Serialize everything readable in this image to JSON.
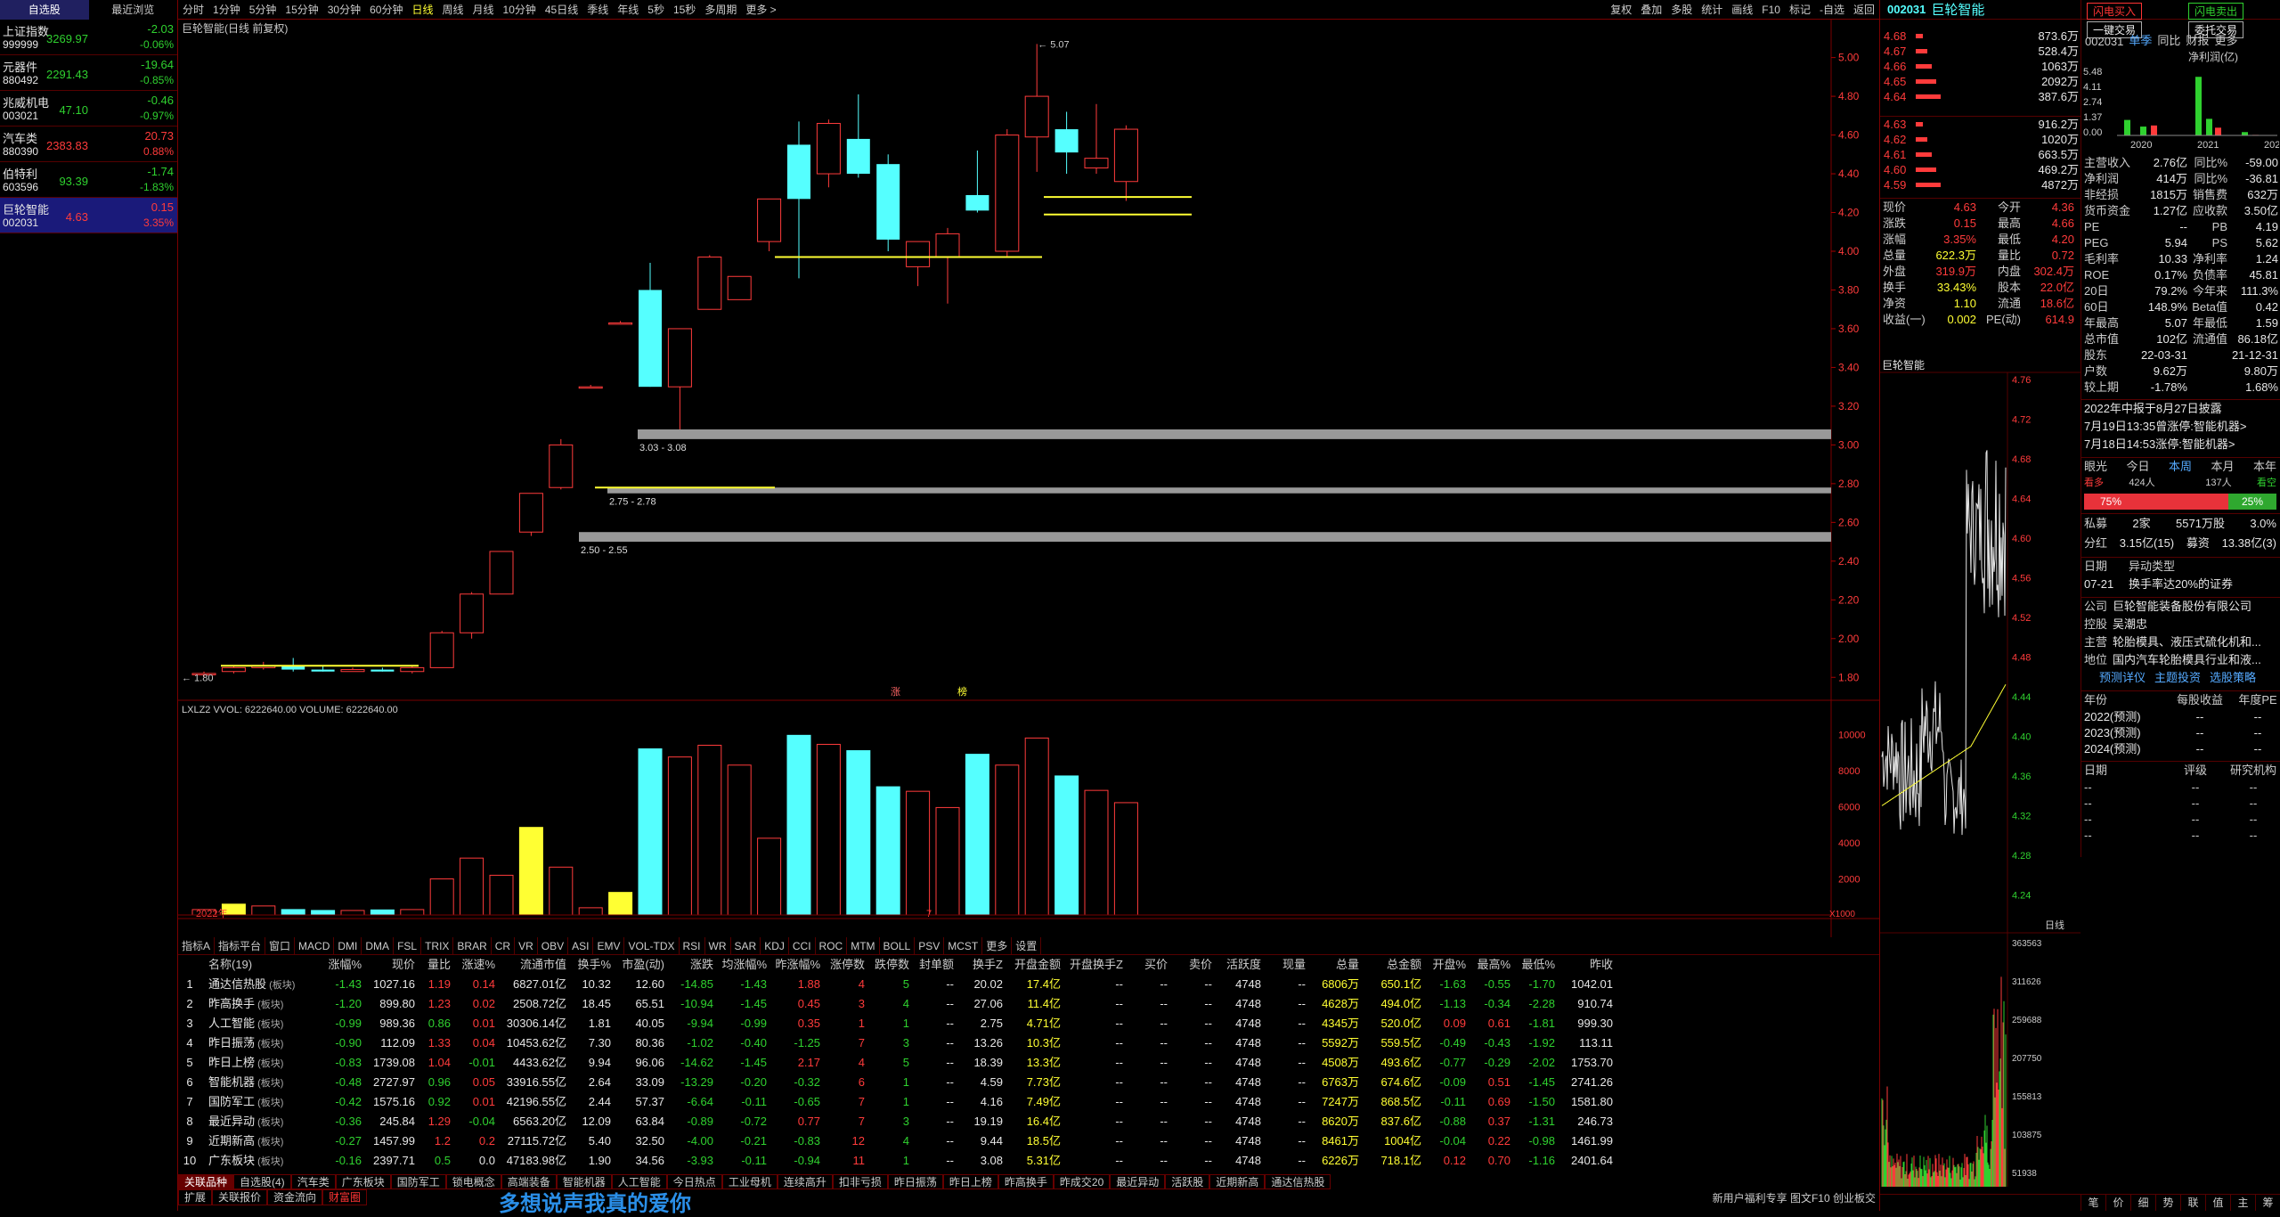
{
  "watchlist": {
    "tabs": [
      "自选股",
      "最近浏览"
    ],
    "items": [
      {
        "name": "上证指数",
        "code": "999999",
        "price": "3269.97",
        "chg": "-2.03",
        "pct": "-0.06%",
        "up": false
      },
      {
        "name": "元器件",
        "code": "880492",
        "price": "2291.43",
        "chg": "-19.64",
        "pct": "-0.85%",
        "up": false
      },
      {
        "name": "兆威机电",
        "code": "003021",
        "price": "47.10",
        "chg": "-0.46",
        "pct": "-0.97%",
        "up": false
      },
      {
        "name": "汽车类",
        "code": "880390",
        "price": "2383.83",
        "chg": "20.73",
        "pct": "0.88%",
        "up": true
      },
      {
        "name": "伯特利",
        "code": "603596",
        "price": "93.39",
        "chg": "-1.74",
        "pct": "-1.83%",
        "up": false
      },
      {
        "name": "巨轮智能",
        "code": "002031",
        "price": "4.63",
        "chg": "0.15",
        "pct": "3.35%",
        "up": true
      }
    ]
  },
  "toolbar": {
    "periods": [
      "分时",
      "1分钟",
      "5分钟",
      "15分钟",
      "30分钟",
      "60分钟",
      "日线",
      "周线",
      "月线",
      "10分钟",
      "45日线",
      "季线",
      "年线",
      "5秒",
      "15秒",
      "多周期",
      "更多 >"
    ],
    "active": "日线",
    "right": [
      "复权",
      "叠加",
      "多股",
      "统计",
      "画线",
      "F10",
      "标记",
      "-自选",
      "返回"
    ]
  },
  "chart": {
    "title": "巨轮智能(日线 前复权)",
    "yticks": [
      "5.00",
      "4.80",
      "4.60",
      "4.40",
      "4.20",
      "4.00",
      "3.80",
      "3.60",
      "3.40",
      "3.20",
      "3.00",
      "2.80",
      "2.60",
      "2.40",
      "2.20",
      "2.00",
      "1.80"
    ],
    "gap_labels": [
      "3.03 - 3.08",
      "2.75 - 2.78",
      "2.50 - 2.55"
    ],
    "high_label": "5.07",
    "low_label": "1.80",
    "event_labels": [
      "涨",
      "榜"
    ],
    "year_label": "2022年",
    "month_label": "7",
    "vol_title": "LXLZ2  VVOL: 6222640.00  VOLUME: 6222640.00",
    "vol_ticks": [
      "10000",
      "8000",
      "6000",
      "4000",
      "2000"
    ],
    "vol_unit": "X1000"
  },
  "chart_data": {
    "type": "candlestick",
    "ylim": [
      1.7,
      5.15
    ],
    "candles": [
      {
        "o": 1.82,
        "h": 1.83,
        "l": 1.8,
        "c": 1.82,
        "up": true
      },
      {
        "o": 1.83,
        "h": 1.86,
        "l": 1.82,
        "c": 1.85,
        "up": true
      },
      {
        "o": 1.85,
        "h": 1.88,
        "l": 1.84,
        "c": 1.86,
        "up": true
      },
      {
        "o": 1.86,
        "h": 1.9,
        "l": 1.83,
        "c": 1.84,
        "up": false
      },
      {
        "o": 1.84,
        "h": 1.86,
        "l": 1.83,
        "c": 1.83,
        "up": false
      },
      {
        "o": 1.83,
        "h": 1.85,
        "l": 1.83,
        "c": 1.84,
        "up": true
      },
      {
        "o": 1.84,
        "h": 1.85,
        "l": 1.83,
        "c": 1.83,
        "up": false
      },
      {
        "o": 1.83,
        "h": 1.86,
        "l": 1.82,
        "c": 1.85,
        "up": true
      },
      {
        "o": 1.85,
        "h": 2.04,
        "l": 1.85,
        "c": 2.03,
        "up": true
      },
      {
        "o": 2.03,
        "h": 2.24,
        "l": 2.0,
        "c": 2.23,
        "up": true
      },
      {
        "o": 2.23,
        "h": 2.45,
        "l": 2.23,
        "c": 2.45,
        "up": true
      },
      {
        "o": 2.55,
        "h": 2.75,
        "l": 2.53,
        "c": 2.75,
        "up": true
      },
      {
        "o": 2.78,
        "h": 3.03,
        "l": 2.77,
        "c": 3.0,
        "up": true
      },
      {
        "o": 3.3,
        "h": 3.31,
        "l": 3.3,
        "c": 3.3,
        "up": true
      },
      {
        "o": 3.63,
        "h": 3.64,
        "l": 3.63,
        "c": 3.63,
        "up": true
      },
      {
        "o": 3.8,
        "h": 3.94,
        "l": 3.3,
        "c": 3.3,
        "up": false
      },
      {
        "o": 3.3,
        "h": 3.6,
        "l": 3.08,
        "c": 3.6,
        "up": true
      },
      {
        "o": 3.7,
        "h": 3.98,
        "l": 3.7,
        "c": 3.97,
        "up": true
      },
      {
        "o": 3.75,
        "h": 3.87,
        "l": 3.75,
        "c": 3.87,
        "up": true
      },
      {
        "o": 4.05,
        "h": 4.27,
        "l": 4.0,
        "c": 4.27,
        "up": true
      },
      {
        "o": 4.27,
        "h": 4.67,
        "l": 3.86,
        "c": 4.55,
        "up": false
      },
      {
        "o": 4.4,
        "h": 4.68,
        "l": 4.33,
        "c": 4.66,
        "up": true
      },
      {
        "o": 4.58,
        "h": 4.81,
        "l": 4.38,
        "c": 4.4,
        "up": false
      },
      {
        "o": 4.45,
        "h": 4.5,
        "l": 4.0,
        "c": 4.06,
        "up": false
      },
      {
        "o": 3.92,
        "h": 4.05,
        "l": 3.82,
        "c": 4.05,
        "up": true
      },
      {
        "o": 3.97,
        "h": 4.12,
        "l": 3.73,
        "c": 4.09,
        "up": true
      },
      {
        "o": 4.21,
        "h": 4.52,
        "l": 4.2,
        "c": 4.29,
        "up": false
      },
      {
        "o": 4.0,
        "h": 4.63,
        "l": 3.97,
        "c": 4.6,
        "up": true
      },
      {
        "o": 4.59,
        "h": 5.07,
        "l": 4.41,
        "c": 4.8,
        "up": true
      },
      {
        "o": 4.63,
        "h": 4.72,
        "l": 4.4,
        "c": 4.51,
        "up": false
      },
      {
        "o": 4.43,
        "h": 4.76,
        "l": 4.4,
        "c": 4.48,
        "up": true
      },
      {
        "o": 4.36,
        "h": 4.65,
        "l": 4.26,
        "c": 4.63,
        "up": true
      }
    ],
    "volumes": [
      300,
      600,
      500,
      300,
      250,
      250,
      280,
      300,
      2000,
      3150,
      2200,
      4850,
      2650,
      400,
      1250,
      9200,
      8750,
      9400,
      8300,
      4250,
      9950,
      9450,
      9100,
      7100,
      6850,
      5950,
      8900,
      8300,
      9800,
      7700,
      6900,
      6220
    ],
    "vol_up": [
      true,
      false,
      true,
      false,
      false,
      true,
      false,
      true,
      true,
      true,
      true,
      false,
      true,
      true,
      false,
      false,
      true,
      true,
      true,
      true,
      false,
      true,
      false,
      false,
      true,
      true,
      false,
      true,
      true,
      false,
      true,
      true
    ]
  },
  "table": {
    "tabs": [
      "指标A",
      "指标平台",
      "窗口",
      "MACD",
      "DMI",
      "DMA",
      "FSL",
      "TRIX",
      "BRAR",
      "CR",
      "VR",
      "OBV",
      "ASI",
      "EMV",
      "VOL-TDX",
      "RSI",
      "WR",
      "SAR",
      "KDJ",
      "CCI",
      "ROC",
      "MTM",
      "BOLL",
      "PSV",
      "MCST",
      "更多",
      "设置"
    ],
    "headers": [
      "",
      "名称(19)",
      "涨幅%",
      "现价",
      "量比",
      "涨速%",
      "流通市值",
      "换手%",
      "市盈(动)",
      "涨跌",
      "均涨幅%",
      "昨涨幅%",
      "涨停数",
      "跌停数",
      "封单额",
      "换手Z",
      "开盘金额",
      "开盘换手Z",
      "买价",
      "卖价",
      "活跃度",
      "现量",
      "总量",
      "总金额",
      "开盘%",
      "最高%",
      "最低%",
      "昨收"
    ],
    "rows": [
      [
        "1",
        "通达信热股",
        "-1.43",
        "1027.16",
        "1.19",
        "0.14",
        "6827.01亿",
        "10.32",
        "12.60",
        "-14.85",
        "-1.43",
        "1.88",
        "4",
        "5",
        "--",
        "20.02",
        "17.4亿",
        "--",
        "--",
        "--",
        "4748",
        "--",
        "6806万",
        "650.1亿",
        "-1.63",
        "-0.55",
        "-1.70",
        "1042.01"
      ],
      [
        "2",
        "昨高换手",
        "-1.20",
        "899.80",
        "1.23",
        "0.02",
        "2508.72亿",
        "18.45",
        "65.51",
        "-10.94",
        "-1.45",
        "0.45",
        "3",
        "4",
        "--",
        "27.06",
        "11.4亿",
        "--",
        "--",
        "--",
        "4748",
        "--",
        "4628万",
        "494.0亿",
        "-1.13",
        "-0.34",
        "-2.28",
        "910.74"
      ],
      [
        "3",
        "人工智能",
        "-0.99",
        "989.36",
        "0.86",
        "0.01",
        "30306.14亿",
        "1.81",
        "40.05",
        "-9.94",
        "-0.99",
        "0.35",
        "1",
        "1",
        "--",
        "2.75",
        "4.71亿",
        "--",
        "--",
        "--",
        "4748",
        "--",
        "4345万",
        "520.0亿",
        "0.09",
        "0.61",
        "-1.81",
        "999.30"
      ],
      [
        "4",
        "昨日振荡",
        "-0.90",
        "112.09",
        "1.33",
        "0.04",
        "10453.62亿",
        "7.30",
        "80.36",
        "-1.02",
        "-0.40",
        "-1.25",
        "7",
        "3",
        "--",
        "13.26",
        "10.3亿",
        "--",
        "--",
        "--",
        "4748",
        "--",
        "5592万",
        "559.5亿",
        "-0.49",
        "-0.43",
        "-1.92",
        "113.11"
      ],
      [
        "5",
        "昨日上榜",
        "-0.83",
        "1739.08",
        "1.04",
        "-0.01",
        "4433.62亿",
        "9.94",
        "96.06",
        "-14.62",
        "-1.45",
        "2.17",
        "4",
        "5",
        "--",
        "18.39",
        "13.3亿",
        "--",
        "--",
        "--",
        "4748",
        "--",
        "4508万",
        "493.6亿",
        "-0.77",
        "-0.29",
        "-2.02",
        "1753.70"
      ],
      [
        "6",
        "智能机器",
        "-0.48",
        "2727.97",
        "0.96",
        "0.05",
        "33916.55亿",
        "2.64",
        "33.09",
        "-13.29",
        "-0.20",
        "-0.32",
        "6",
        "1",
        "--",
        "4.59",
        "7.73亿",
        "--",
        "--",
        "--",
        "4748",
        "--",
        "6763万",
        "674.6亿",
        "-0.09",
        "0.51",
        "-1.45",
        "2741.26"
      ],
      [
        "7",
        "国防军工",
        "-0.42",
        "1575.16",
        "0.92",
        "0.01",
        "42196.55亿",
        "2.44",
        "57.37",
        "-6.64",
        "-0.11",
        "-0.65",
        "7",
        "1",
        "--",
        "4.16",
        "7.49亿",
        "--",
        "--",
        "--",
        "4748",
        "--",
        "7247万",
        "868.5亿",
        "-0.11",
        "0.69",
        "-1.50",
        "1581.80"
      ],
      [
        "8",
        "最近异动",
        "-0.36",
        "245.84",
        "1.29",
        "-0.04",
        "6563.20亿",
        "12.09",
        "63.84",
        "-0.89",
        "-0.72",
        "0.77",
        "7",
        "3",
        "--",
        "19.19",
        "16.4亿",
        "--",
        "--",
        "--",
        "4748",
        "--",
        "8620万",
        "837.6亿",
        "-0.88",
        "0.37",
        "-1.31",
        "246.73"
      ],
      [
        "9",
        "近期新高",
        "-0.27",
        "1457.99",
        "1.2",
        "0.2",
        "27115.72亿",
        "5.40",
        "32.50",
        "-4.00",
        "-0.21",
        "-0.83",
        "12",
        "4",
        "--",
        "9.44",
        "18.5亿",
        "--",
        "--",
        "--",
        "4748",
        "--",
        "8461万",
        "1004亿",
        "-0.04",
        "0.22",
        "-0.98",
        "1461.99"
      ],
      [
        "10",
        "广东板块",
        "-0.16",
        "2397.71",
        "0.5",
        "0.0",
        "47183.98亿",
        "1.90",
        "34.56",
        "-3.93",
        "-0.11",
        "-0.94",
        "11",
        "1",
        "--",
        "3.08",
        "5.31亿",
        "--",
        "--",
        "--",
        "4748",
        "--",
        "6226万",
        "718.1亿",
        "0.12",
        "0.70",
        "-1.16",
        "2401.64"
      ]
    ],
    "tag": "板块"
  },
  "bottom": {
    "tabs": [
      "关联品种",
      "自选股(4)",
      "汽车类",
      "广东板块",
      "国防军工",
      "锁电概念",
      "高端装备",
      "智能机器",
      "人工智能",
      "今日热点",
      "工业母机",
      "连续高升",
      "扣非亏损",
      "昨日振荡",
      "昨日上榜",
      "昨高换手",
      "昨成交20",
      "最近异动",
      "活跃股",
      "近期新高",
      "通达信热股"
    ],
    "tabs2": [
      "扩展",
      "关联报价",
      "资金流向",
      "财富圈"
    ],
    "subtitle": "多想说声我真的爱你",
    "status": "新用户福利专享 图文F10 创业板交"
  },
  "right": {
    "code": "002031",
    "name": "巨轮智能",
    "btn1": "闪电买入",
    "btn2": "闪电卖出",
    "btn3": "一键交易",
    "btn4": "委托交易",
    "asks": [
      [
        "4.68",
        "873.6万"
      ],
      [
        "4.67",
        "528.4万"
      ],
      [
        "4.66",
        "1063万"
      ],
      [
        "4.65",
        "2092万"
      ],
      [
        "4.64",
        "387.6万"
      ]
    ],
    "bids": [
      [
        "4.63",
        "916.2万"
      ],
      [
        "4.62",
        "1020万"
      ],
      [
        "4.61",
        "663.5万"
      ],
      [
        "4.60",
        "469.2万"
      ],
      [
        "4.59",
        "4872万"
      ]
    ],
    "bid_labels": [
      "4",
      "4",
      "4",
      "4",
      "4"
    ],
    "quote": [
      [
        "现价",
        "4.63",
        "今开",
        "4.36"
      ],
      [
        "涨跌",
        "0.15",
        "最高",
        "4.66"
      ],
      [
        "涨幅",
        "3.35%",
        "最低",
        "4.20"
      ],
      [
        "总量",
        "622.3万",
        "量比",
        "0.72"
      ],
      [
        "外盘",
        "319.9万",
        "内盘",
        "302.4万"
      ],
      [
        "换手",
        "33.43%",
        "股本",
        "22.0亿"
      ],
      [
        "净资",
        "1.10",
        "流通",
        "18.6亿"
      ],
      [
        "收益(一)",
        "0.002",
        "PE(动)",
        "614.9"
      ]
    ],
    "fin_tabs": [
      "002031",
      "单季",
      "同比",
      "财报",
      "更多"
    ],
    "fin_label": "净利润(亿)",
    "fin_ticks": [
      "5.48",
      "4.11",
      "2.74",
      "1.37",
      "0.00"
    ],
    "fin_years": [
      "2020",
      "2021",
      "2022"
    ],
    "fin": [
      [
        "主营收入",
        "2.76亿",
        "同比%",
        "-59.00"
      ],
      [
        "净利润",
        "414万",
        "同比%",
        "-36.81"
      ],
      [
        "非经损",
        "1815万",
        "销售费",
        "632万"
      ],
      [
        "货币资金",
        "1.27亿",
        "应收款",
        "3.50亿"
      ],
      [
        "PE",
        "--",
        "PB",
        "4.19"
      ],
      [
        "PEG",
        "5.94",
        "PS",
        "5.62"
      ],
      [
        "毛利率",
        "10.33",
        "净利率",
        "1.24"
      ],
      [
        "ROE",
        "0.17%",
        "负债率",
        "45.81"
      ],
      [
        "20日",
        "79.2%",
        "今年来",
        "111.3%"
      ],
      [
        "60日",
        "148.9%",
        "Beta值",
        "0.42"
      ],
      [
        "年最高",
        "5.07",
        "年最低",
        "1.59"
      ],
      [
        "总市值",
        "102亿",
        "流通值",
        "86.18亿"
      ],
      [
        "股东",
        "22-03-31",
        "",
        "21-12-31"
      ],
      [
        "户数",
        "9.62万",
        "",
        "9.80万"
      ],
      [
        "较上期",
        "-1.78%",
        "",
        "1.68%"
      ]
    ],
    "mini_title": "巨轮智能",
    "mini_ticks": [
      "4.76",
      "4.72",
      "4.68",
      "4.64",
      "4.60",
      "4.56",
      "4.52",
      "4.48",
      "4.44",
      "4.40",
      "4.36",
      "4.32",
      "4.28",
      "4.24"
    ],
    "mini_vol_ticks": [
      "363563",
      "311626",
      "259688",
      "207750",
      "155813",
      "103875",
      "51938"
    ],
    "mini_tab": "日线",
    "news": [
      "2022年中报于8月27日披露",
      "7月19日13:35曾涨停:智能机器>",
      "7月18日14:53涨停:智能机器>"
    ],
    "eye": [
      "眼光",
      "今日",
      "本周",
      "本月",
      "本年"
    ],
    "eye2": [
      "看多",
      "424人",
      "",
      "137人",
      "看空"
    ],
    "bull": "75%",
    "bear": "25%",
    "inst": [
      [
        "私募",
        "2家",
        "5571万股",
        "3.0%"
      ],
      [
        "分红",
        "3.15亿(15)",
        "募资",
        "13.38亿(3)"
      ]
    ],
    "event_date": "07-21",
    "event_title": "异动类型",
    "event_text": "换手率达20%的证券",
    "company": [
      [
        "公司",
        "巨轮智能装备股份有限公司"
      ],
      [
        "控股",
        "吴潮忠"
      ],
      [
        "主营",
        "轮胎模具、液压式硫化机和..."
      ],
      [
        "地位",
        "国内汽车轮胎模具行业和液..."
      ]
    ],
    "links": [
      "预测详仪",
      "主题投资",
      "选股策略"
    ],
    "forecast_headers": [
      "年份",
      "每股收益",
      "年度PE"
    ],
    "forecast": [
      [
        "2022(预测)",
        "--",
        "--"
      ],
      [
        "2023(预测)",
        "--",
        "--"
      ],
      [
        "2024(预测)",
        "--",
        "--"
      ]
    ],
    "rating_headers": [
      "日期",
      "评级",
      "研究机构"
    ],
    "bottom_tabs": [
      "笔",
      "价",
      "细",
      "势",
      "联",
      "值",
      "主",
      "筹"
    ]
  }
}
